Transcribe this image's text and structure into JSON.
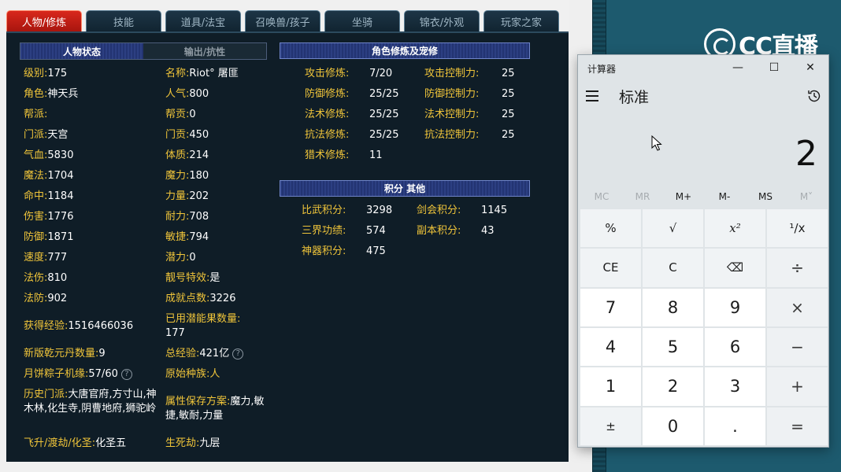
{
  "game": {
    "tabs": [
      {
        "label": "人物/修炼",
        "active": true
      },
      {
        "label": "技能",
        "active": false
      },
      {
        "label": "道具/法宝",
        "active": false
      },
      {
        "label": "召唤兽/孩子",
        "active": false
      },
      {
        "label": "坐骑",
        "active": false
      },
      {
        "label": "锦衣/外观",
        "active": false
      },
      {
        "label": "玩家之家",
        "active": false
      }
    ],
    "subtabs": {
      "status": "人物状态",
      "output": "输出/抗性"
    },
    "stats_left": [
      {
        "label": "级别:",
        "value": "175"
      },
      {
        "label": "角色:",
        "value": "神天兵"
      },
      {
        "label": "帮派:",
        "value": ""
      },
      {
        "label": "门派:",
        "value": "天宫"
      },
      {
        "label": "气血:",
        "value": "5830"
      },
      {
        "label": "魔法:",
        "value": "1704"
      },
      {
        "label": "命中:",
        "value": "1184"
      },
      {
        "label": "伤害:",
        "value": "1776"
      },
      {
        "label": "防御:",
        "value": "1871"
      },
      {
        "label": "速度:",
        "value": "777"
      },
      {
        "label": "法伤:",
        "value": "810"
      },
      {
        "label": "法防:",
        "value": "902"
      }
    ],
    "stats_right": [
      {
        "label": "名称:",
        "value": "Riot° 屠匪"
      },
      {
        "label": "人气:",
        "value": "800"
      },
      {
        "label": "帮贡:",
        "value": "0"
      },
      {
        "label": "门贡:",
        "value": "450"
      },
      {
        "label": "体质:",
        "value": "214"
      },
      {
        "label": "魔力:",
        "value": "180"
      },
      {
        "label": "力量:",
        "value": "202"
      },
      {
        "label": "耐力:",
        "value": "708"
      },
      {
        "label": "敏捷:",
        "value": "794"
      },
      {
        "label": "潜力:",
        "value": "0"
      },
      {
        "label": "靓号特效:",
        "value": "是"
      },
      {
        "label": "成就点数:",
        "value": "3226"
      }
    ],
    "exp": {
      "label": "获得经验:",
      "value": "1516466036"
    },
    "used_potential": {
      "label": "已用潜能果数量:",
      "value": "177"
    },
    "qianyuan": {
      "label": "新版乾元丹数量:",
      "value": "9"
    },
    "total_exp": {
      "label": "总经验:",
      "value": "421亿"
    },
    "mooncake": {
      "label": "月饼粽子机缘:",
      "value": "57/60"
    },
    "race": {
      "label": "原始种族:",
      "value": "人"
    },
    "history": {
      "label": "历史门派:",
      "value": "大唐官府,方寸山,神木林,化生寺,阴曹地府,狮驼岭"
    },
    "attr_save": {
      "label": "属性保存方案:",
      "value": "魔力,敏捷,敏耐,力量"
    },
    "ascend": {
      "label": "飞升/渡劫/化圣:",
      "value": "化圣五"
    },
    "tribulation": {
      "label": "生死劫:",
      "value": "九层"
    },
    "qmark": "?",
    "cultivation_title": "角色修炼及宠修",
    "cultivation_left": [
      {
        "label": "攻击修炼:",
        "value": "7/20"
      },
      {
        "label": "防御修炼:",
        "value": "25/25"
      },
      {
        "label": "法术修炼:",
        "value": "25/25"
      },
      {
        "label": "抗法修炼:",
        "value": "25/25"
      },
      {
        "label": "猎术修炼:",
        "value": "11"
      }
    ],
    "cultivation_right": [
      {
        "label": "攻击控制力:",
        "value": "25"
      },
      {
        "label": "防御控制力:",
        "value": "25"
      },
      {
        "label": "法术控制力:",
        "value": "25"
      },
      {
        "label": "抗法控制力:",
        "value": "25"
      }
    ],
    "points_title": "积分 其他",
    "points_left": [
      {
        "label": "比武积分:",
        "value": "3298"
      },
      {
        "label": "三界功绩:",
        "value": "574"
      },
      {
        "label": "神器积分:",
        "value": "475"
      }
    ],
    "points_right": [
      {
        "label": "剑会积分:",
        "value": "1145"
      },
      {
        "label": "副本积分:",
        "value": "43"
      }
    ]
  },
  "logo": {
    "text": "CC直播"
  },
  "calculator": {
    "title": "计算器",
    "mode": "标准",
    "display": "2",
    "window_buttons": {
      "minimize": "—",
      "maximize": "☐",
      "close": "✕"
    },
    "memory": [
      "MC",
      "MR",
      "M+",
      "M-",
      "MS",
      "M˅"
    ],
    "keys": [
      [
        "%",
        "√",
        "x²",
        "¹/x"
      ],
      [
        "CE",
        "C",
        "⌫",
        "÷"
      ],
      [
        "7",
        "8",
        "9",
        "×"
      ],
      [
        "4",
        "5",
        "6",
        "−"
      ],
      [
        "1",
        "2",
        "3",
        "+"
      ],
      [
        "±",
        "0",
        ".",
        "="
      ]
    ]
  },
  "colors": {
    "label": "#f0c53a",
    "value": "#ffffff",
    "panel_bg": "#0f1d27",
    "active_tab": "#c9221a",
    "section_bar": "#2c3f82",
    "calc_bg": "#dfe4e7"
  }
}
